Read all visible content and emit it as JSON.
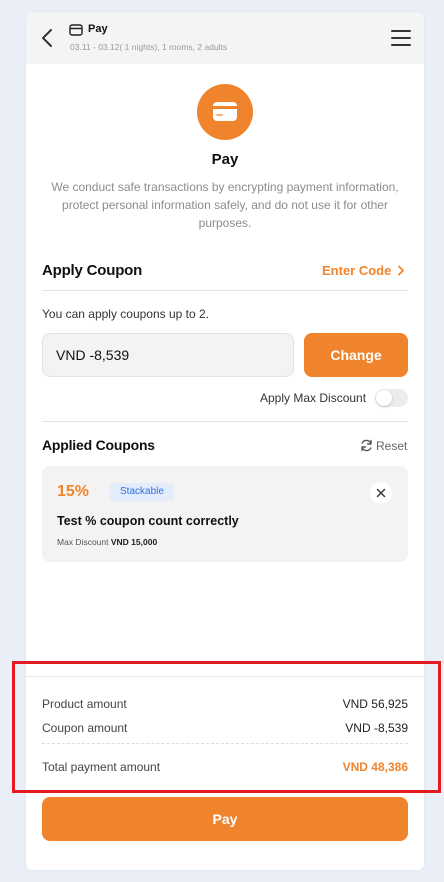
{
  "header": {
    "title": "Pay",
    "subtitle": "03.11 - 03.12( 1 nights), 1 rooms, 2 adults"
  },
  "hero": {
    "title": "Pay",
    "description": "We conduct safe transactions by encrypting payment information, protect personal information safely, and do not use it for other purposes."
  },
  "coupon": {
    "section_title": "Apply Coupon",
    "enter_code_label": "Enter Code",
    "note": "You can apply coupons up to 2.",
    "input_value": "VND  -8,539",
    "change_label": "Change",
    "max_discount_label": "Apply Max Discount",
    "max_discount_on": false
  },
  "applied": {
    "section_title": "Applied Coupons",
    "reset_label": "Reset",
    "items": [
      {
        "percent": "15%",
        "badge": "Stackable",
        "name": "Test % coupon count correctly",
        "max_discount_prefix": "Max Discount",
        "max_discount_value": "VND 15,000"
      }
    ]
  },
  "summary": {
    "product_label": "Product amount",
    "product_value": "VND 56,925",
    "coupon_label": "Coupon amount",
    "coupon_value": "VND -8,539",
    "total_label": "Total payment amount",
    "total_value": "VND 48,386"
  },
  "pay_button_label": "Pay",
  "colors": {
    "accent": "#f0842c",
    "badge_bg": "#e3ecfb",
    "badge_text": "#2f6fe0",
    "highlight": "#e21b23"
  },
  "icons": {
    "back": "chevron-left-icon",
    "header": "card-icon",
    "menu": "hamburger-icon",
    "hero": "credit-card-icon",
    "enter_code": "chevron-right-icon",
    "reset": "refresh-icon",
    "remove": "close-icon"
  }
}
